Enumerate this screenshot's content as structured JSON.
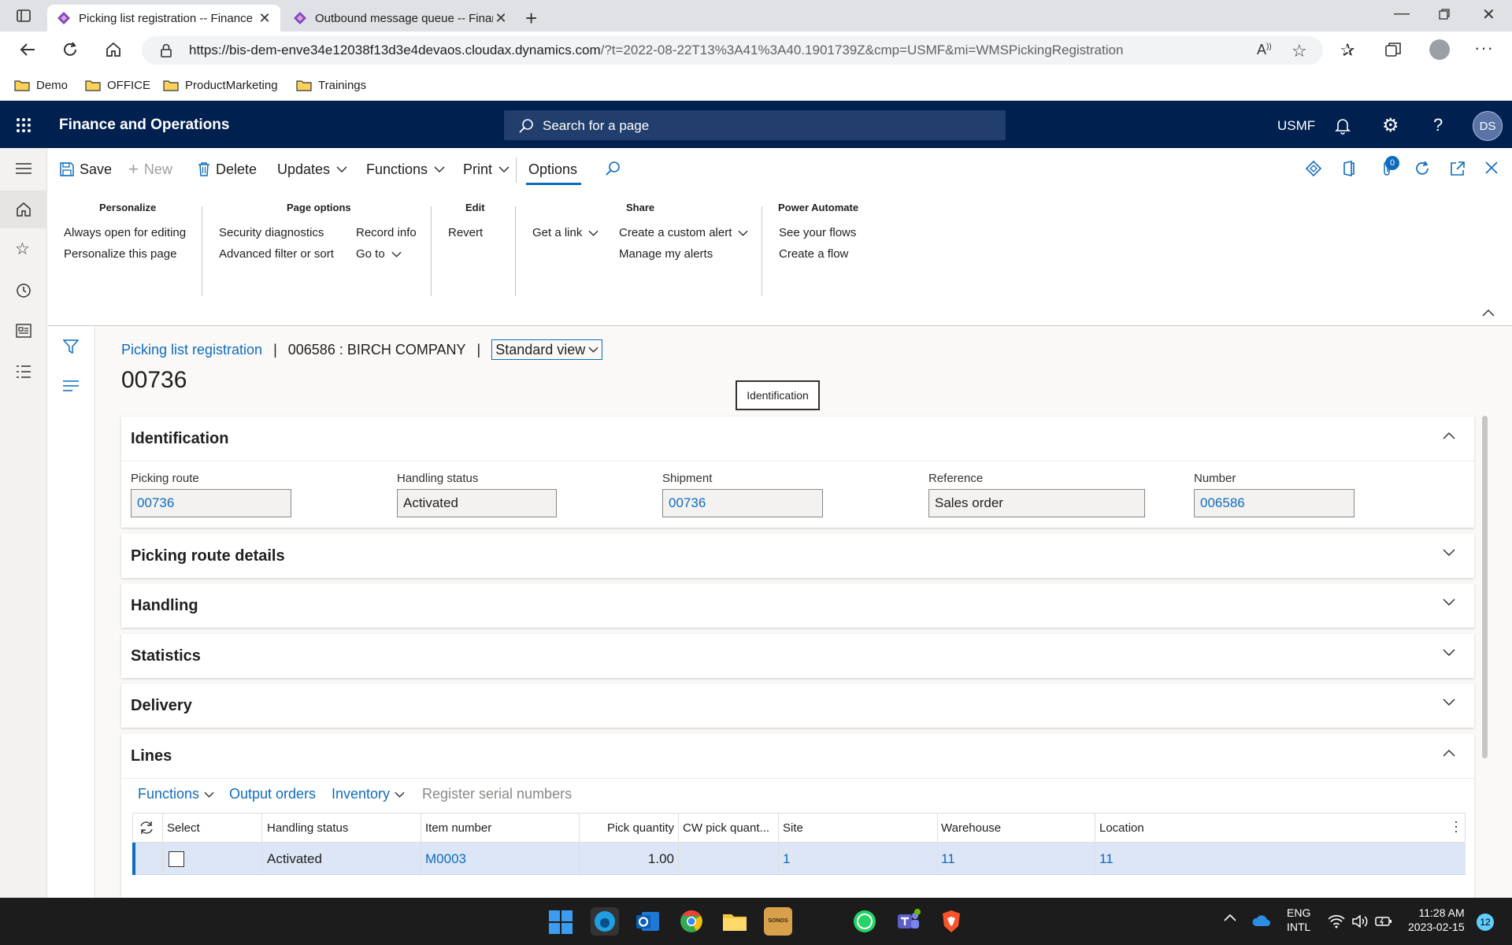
{
  "browser": {
    "tabs": [
      {
        "title": "Picking list registration -- Finance and Operations",
        "active": true
      },
      {
        "title": "Outbound message queue -- Finance and Operations",
        "active": false
      }
    ],
    "url_host": "https://bis-dem-enve34e12038f13d3e4devaos.cloudax.dynamics.com",
    "url_rest": "/?t=2022-08-22T13%3A41%3A40.1901739Z&cmp=USMF&mi=WMSPickingRegistration",
    "bookmarks": [
      "Demo",
      "OFFICE",
      "ProductMarketing",
      "Trainings"
    ]
  },
  "app": {
    "name": "Finance and Operations",
    "search_placeholder": "Search for a page",
    "company": "USMF",
    "avatar": "DS",
    "badge_count": "0"
  },
  "actions": {
    "save": "Save",
    "new": "New",
    "delete": "Delete",
    "updates": "Updates",
    "functions": "Functions",
    "print": "Print",
    "options": "Options"
  },
  "options_groups": {
    "personalize": {
      "header": "Personalize",
      "items": [
        "Always open for editing",
        "Personalize this page"
      ]
    },
    "page_options": {
      "header": "Page options",
      "items": [
        "Security diagnostics",
        "Advanced filter or sort",
        "Record info",
        "Go to"
      ]
    },
    "edit": {
      "header": "Edit",
      "items": [
        "Revert"
      ]
    },
    "share": {
      "header": "Share",
      "items": [
        "Get a link",
        "Create a custom alert",
        "Manage my alerts"
      ]
    },
    "power_automate": {
      "header": "Power Automate",
      "items": [
        "See your flows",
        "Create a flow"
      ]
    }
  },
  "breadcrumb": {
    "page": "Picking list registration",
    "record": "006586 : BIRCH COMPANY",
    "view": "Standard view"
  },
  "record_title": "00736",
  "tooltip": "Identification",
  "identification": {
    "title": "Identification",
    "fields": [
      {
        "label": "Picking route",
        "value": "00736",
        "link": true
      },
      {
        "label": "Handling status",
        "value": "Activated",
        "link": false
      },
      {
        "label": "Shipment",
        "value": "00736",
        "link": true
      },
      {
        "label": "Reference",
        "value": "Sales order",
        "link": false
      },
      {
        "label": "Number",
        "value": "006586",
        "link": true
      }
    ]
  },
  "fasttabs": [
    "Picking route details",
    "Handling",
    "Statistics",
    "Delivery"
  ],
  "lines": {
    "title": "Lines",
    "toolbar": {
      "functions": "Functions",
      "output_orders": "Output orders",
      "inventory": "Inventory",
      "register_serial": "Register serial numbers"
    },
    "columns": [
      "Select",
      "Handling status",
      "Item number",
      "Pick quantity",
      "CW pick quant...",
      "Site",
      "Warehouse",
      "Location"
    ],
    "rows": [
      {
        "handling_status": "Activated",
        "item_number": "M0003",
        "pick_quantity": "1.00",
        "cw_pick_quantity": "",
        "site": "1",
        "warehouse": "11",
        "location": "11"
      }
    ]
  },
  "taskbar": {
    "lang1": "ENG",
    "lang2": "INTL",
    "time": "11:28 AM",
    "date": "2023-02-15",
    "notifications": "12"
  }
}
